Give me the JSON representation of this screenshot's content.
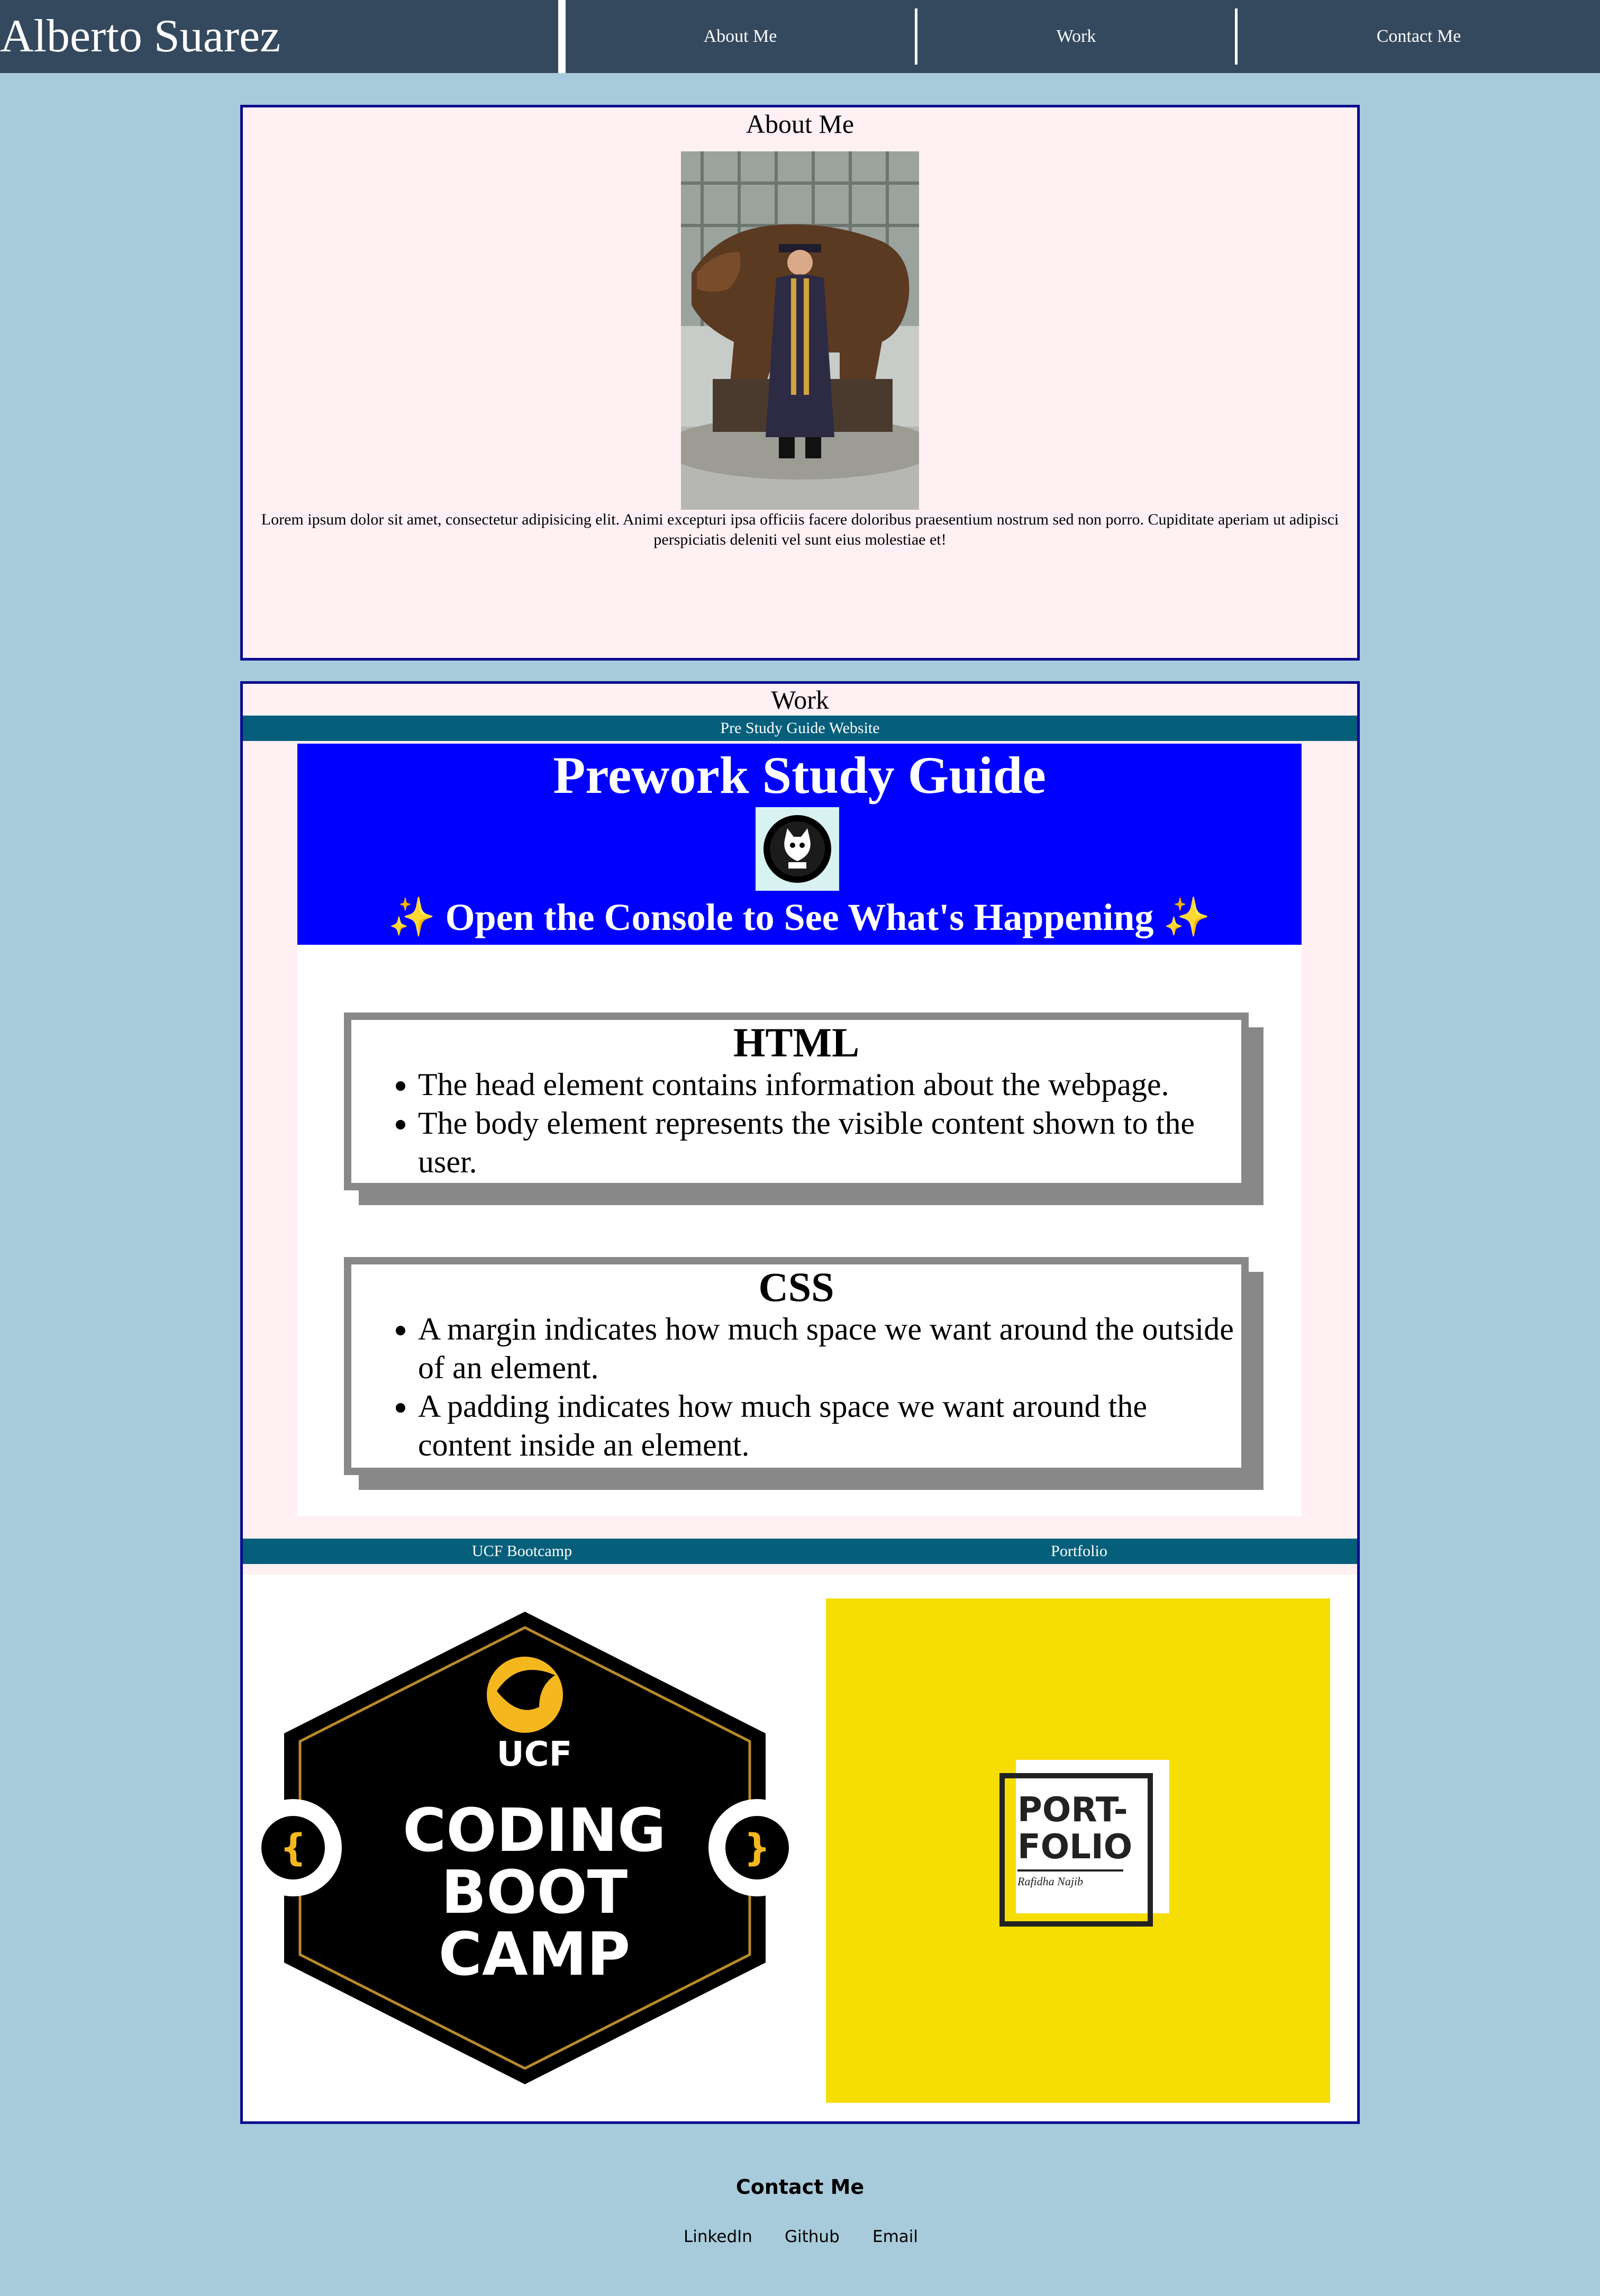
{
  "header": {
    "site_title": "Alberto Suarez",
    "nav": [
      "About Me",
      "Work",
      "Contact Me"
    ]
  },
  "about": {
    "heading": "About Me",
    "body": "Lorem ipsum dolor sit amet, consectetur adipisicing elit. Animi excepturi ipsa officiis facere doloribus praesentium nostrum sed non porro. Cupiditate aperiam ut adipisci perspiciatis deleniti vel sunt eius molestiae et!"
  },
  "work": {
    "heading": "Work",
    "project1": {
      "label": "Pre Study Guide Website",
      "page_title": "Prework Study Guide",
      "page_subtitle": "✨ Open the Console to See What's Happening ✨",
      "cards": [
        {
          "title": "HTML",
          "items": [
            "The head element contains information about the webpage.",
            "The body element represents the visible content shown to the user."
          ]
        },
        {
          "title": "CSS",
          "items": [
            "A margin indicates how much space we want around the outside of an element.",
            "A padding indicates how much space we want around the content inside an element."
          ]
        }
      ]
    },
    "project2": {
      "label": "UCF Bootcamp",
      "logo_lines": [
        "UCF",
        "CODING",
        "BOOT",
        "CAMP"
      ]
    },
    "project3": {
      "label": "Portfolio",
      "logo_lines": [
        "PORT-",
        "FOLIO"
      ],
      "logo_signature": "Rafidha Najib"
    }
  },
  "footer": {
    "heading": "Contact Me",
    "links": [
      "LinkedIn",
      "Github",
      "Email"
    ]
  },
  "colors": {
    "page_bg": "#a7cbdb",
    "header_bg": "#34495e",
    "section_border": "#0b0b8f",
    "section_bg": "#fff0f3",
    "project_bar": "#055f7b",
    "guide_blue": "#0000ff",
    "portfolio_yellow": "#f6de05"
  }
}
